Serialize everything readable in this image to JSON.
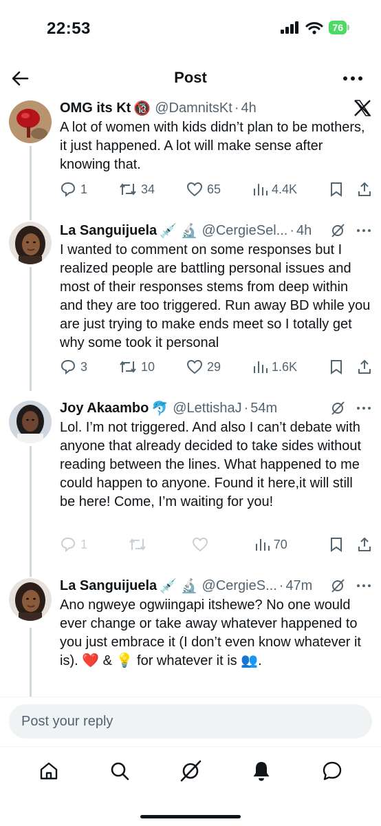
{
  "status": {
    "time": "22:53",
    "battery": "76"
  },
  "nav": {
    "title": "Post"
  },
  "posts": [
    {
      "author": "OMG its Kt",
      "badge": "🔞",
      "handle": "@DamnitsKt",
      "time": "4h",
      "text": "A lot of women with kids didn’t plan to be mothers, it just happened. A lot will make sense after knowing that.",
      "replies": "1",
      "reposts": "34",
      "likes": "65",
      "views": "4.4K"
    },
    {
      "author": "La Sanguijuela",
      "badge": "💉 🔬",
      "handle": "@CergieSel...",
      "time": "4h",
      "text": "I wanted to comment on some responses but I realized people are battling personal issues and most of their responses stems from deep within and they are too triggered. Run away BD while you are just trying to make ends meet so I totally get why some took it personal",
      "replies": "3",
      "reposts": "10",
      "likes": "29",
      "views": "1.6K"
    },
    {
      "author": "Joy Akaambo",
      "badge": "🐬",
      "handle": "@LettishaJ",
      "time": "54m",
      "text": "Lol. I’m not triggered. And also I can’t debate with anyone that already decided to take sides without reading between the lines. What happened to me could happen to anyone. Found it here,it will still be here! Come, I’m waiting for you!",
      "replies": "1",
      "reposts": "",
      "likes": "",
      "views": "70"
    },
    {
      "author": "La Sanguijuela",
      "badge": "💉 🔬",
      "handle": "@CergieS...",
      "time": "47m",
      "text": "Ano ngweye ogwiingapi itshewe? No one would ever change or take away whatever happened to you just embrace it (I don’t even know whatever it is). ❤️ & 💡 for whatever it is 👥."
    }
  ],
  "reply": {
    "placeholder": "Post your reply"
  },
  "colors": {
    "text": "#0f1419",
    "secondary": "#536471",
    "thread": "#cfd9de",
    "battery": "#4cd964"
  }
}
